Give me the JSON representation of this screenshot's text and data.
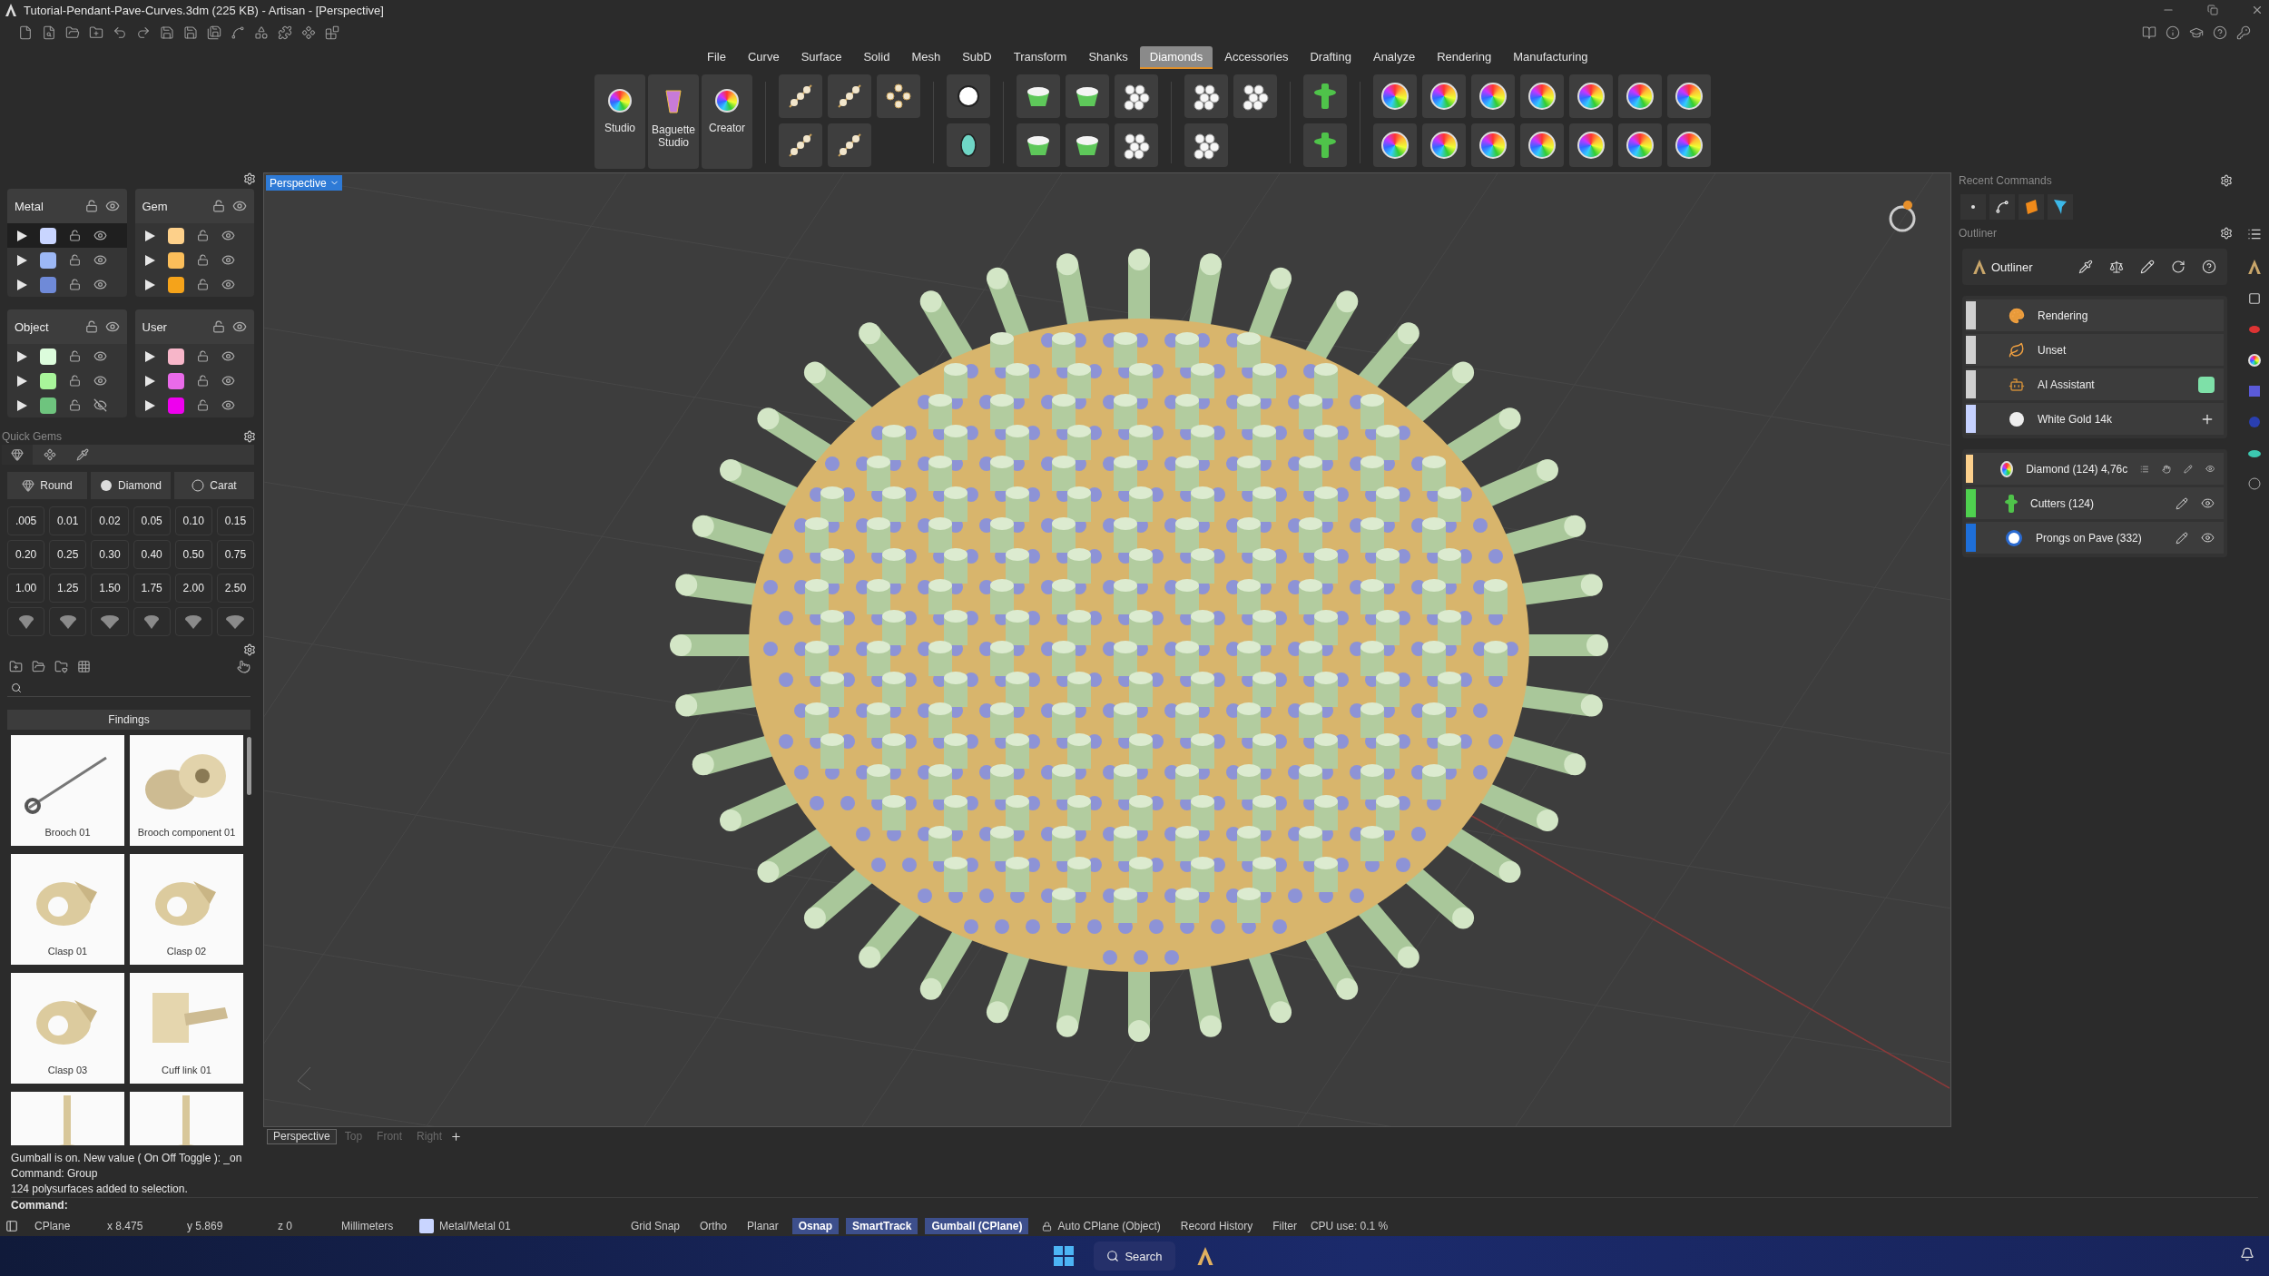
{
  "window": {
    "title": "Tutorial-Pendant-Pave-Curves.3dm (225 KB) - Artisan - [Perspective]"
  },
  "ribbon": {
    "tabs": [
      {
        "label": "File",
        "selected": false
      },
      {
        "label": "Curve",
        "selected": false
      },
      {
        "label": "Surface",
        "selected": false
      },
      {
        "label": "Solid",
        "selected": false
      },
      {
        "label": "Mesh",
        "selected": false
      },
      {
        "label": "SubD",
        "selected": false
      },
      {
        "label": "Transform",
        "selected": false
      },
      {
        "label": "Shanks",
        "selected": false
      },
      {
        "label": "Diamonds",
        "selected": true
      },
      {
        "label": "Accessories",
        "selected": false
      },
      {
        "label": "Drafting",
        "selected": false
      },
      {
        "label": "Analyze",
        "selected": false
      },
      {
        "label": "Rendering",
        "selected": false
      },
      {
        "label": "Manufacturing",
        "selected": false
      }
    ],
    "big_buttons": [
      {
        "label": "Studio",
        "kind": "wheel"
      },
      {
        "label": "Baguette Studio",
        "kind": "baguette"
      },
      {
        "label": "Creator",
        "kind": "creator"
      }
    ]
  },
  "layers": {
    "groups": [
      {
        "name": "Metal",
        "layers": [
          {
            "color": "#c9d5ff",
            "visible": true,
            "selected": true
          },
          {
            "color": "#9db8f5",
            "visible": true,
            "selected": false
          },
          {
            "color": "#6f8ad8",
            "visible": true,
            "selected": false
          }
        ]
      },
      {
        "name": "Gem",
        "layers": [
          {
            "color": "#fdd08a",
            "visible": true,
            "selected": false
          },
          {
            "color": "#fbbe5a",
            "visible": true,
            "selected": false
          },
          {
            "color": "#f5a31a",
            "visible": true,
            "selected": false
          }
        ]
      },
      {
        "name": "Object",
        "layers": [
          {
            "color": "#dcfcdc",
            "visible": true,
            "selected": false
          },
          {
            "color": "#a8f59a",
            "visible": true,
            "selected": false
          },
          {
            "color": "#6ec47e",
            "visible": false,
            "selected": false
          }
        ]
      },
      {
        "name": "User",
        "layers": [
          {
            "color": "#f7b6c9",
            "visible": true,
            "selected": false
          },
          {
            "color": "#e96ae9",
            "visible": true,
            "selected": false
          },
          {
            "color": "#ee00ee",
            "visible": true,
            "selected": false
          }
        ]
      }
    ]
  },
  "quick_gems": {
    "title": "Quick Gems",
    "selectors": [
      {
        "label": "Round",
        "kind": "cut"
      },
      {
        "label": "Diamond",
        "kind": "stone"
      },
      {
        "label": "Carat",
        "kind": "unit"
      }
    ],
    "sizes": [
      ".005",
      "0.01",
      "0.02",
      "0.05",
      "0.10",
      "0.15",
      "0.20",
      "0.25",
      "0.30",
      "0.40",
      "0.50",
      "0.75",
      "1.00",
      "1.25",
      "1.50",
      "1.75",
      "2.00",
      "2.50"
    ]
  },
  "library": {
    "section": "Findings",
    "items": [
      {
        "label": "Brooch 01"
      },
      {
        "label": "Brooch component 01"
      },
      {
        "label": "Clasp 01"
      },
      {
        "label": "Clasp 02"
      },
      {
        "label": "Clasp 03"
      },
      {
        "label": "Cuff link 01"
      },
      {
        "kind": "picture"
      },
      {
        "kind": "picture"
      }
    ]
  },
  "viewport": {
    "name": "Perspective",
    "tabs": [
      {
        "label": "Perspective",
        "selected": true
      },
      {
        "label": "Top",
        "selected": false
      },
      {
        "label": "Front",
        "selected": false
      },
      {
        "label": "Right",
        "selected": false
      }
    ]
  },
  "recent_commands": {
    "title": "Recent Commands"
  },
  "outliner": {
    "title": "Outliner",
    "heading": "Outliner",
    "materials": [
      {
        "name": "Rendering",
        "color": "#d0d0d0",
        "kind": "palette"
      },
      {
        "name": "Unset",
        "color": "#d0d0d0",
        "kind": "leaf"
      },
      {
        "name": "AI Assistant",
        "color": "#d0d0d0",
        "kind": "robot",
        "swatch": {
          "color": "#7ee0a8"
        }
      },
      {
        "name": "White Gold 14k",
        "color": "#c6d2ff",
        "kind": "metal",
        "add": true
      }
    ],
    "objects": [
      {
        "name": "Diamond (124) 4,76c",
        "color": "#fcd08c",
        "kind": "gem",
        "actions": [
          {
            "kind": "list"
          },
          {
            "kind": "hand"
          },
          {
            "kind": "edit"
          },
          {
            "kind": "view"
          }
        ]
      },
      {
        "name": "Cutters (124)",
        "color": "#4fd14f",
        "kind": "cutter",
        "actions": [
          {
            "kind": "edit"
          },
          {
            "kind": "view"
          }
        ]
      },
      {
        "name": "Prongs on Pave (332)",
        "color": "#1e6fd9",
        "kind": "prong",
        "actions": [
          {
            "kind": "edit"
          },
          {
            "kind": "view"
          }
        ]
      }
    ]
  },
  "command_line": {
    "history": [
      "Gumball is on. New value ( On  Off  Toggle ): _on",
      "Command: Group",
      "124 polysurfaces added to selection."
    ],
    "prompt": "Command:"
  },
  "status_bar": {
    "cplane": "CPlane",
    "x": "x 8.475",
    "y": "y 5.869",
    "z": "z 0",
    "units": "Millimeters",
    "layer": {
      "label": "Metal/Metal 01",
      "color": "#c9d5ff"
    },
    "toggles": [
      {
        "label": "Grid Snap",
        "on": false
      },
      {
        "label": "Ortho",
        "on": false
      },
      {
        "label": "Planar",
        "on": false
      },
      {
        "label": "Osnap",
        "on": true
      },
      {
        "label": "SmartTrack",
        "on": true
      },
      {
        "label": "Gumball (CPlane)",
        "on": true
      },
      {
        "label": "Auto CPlane (Object)",
        "on": false,
        "locked": true
      },
      {
        "label": "Record History",
        "on": false
      },
      {
        "label": "Filter",
        "on": false
      }
    ],
    "cpu": "CPU use: 0.1 %"
  },
  "taskbar": {
    "search": "Search"
  }
}
